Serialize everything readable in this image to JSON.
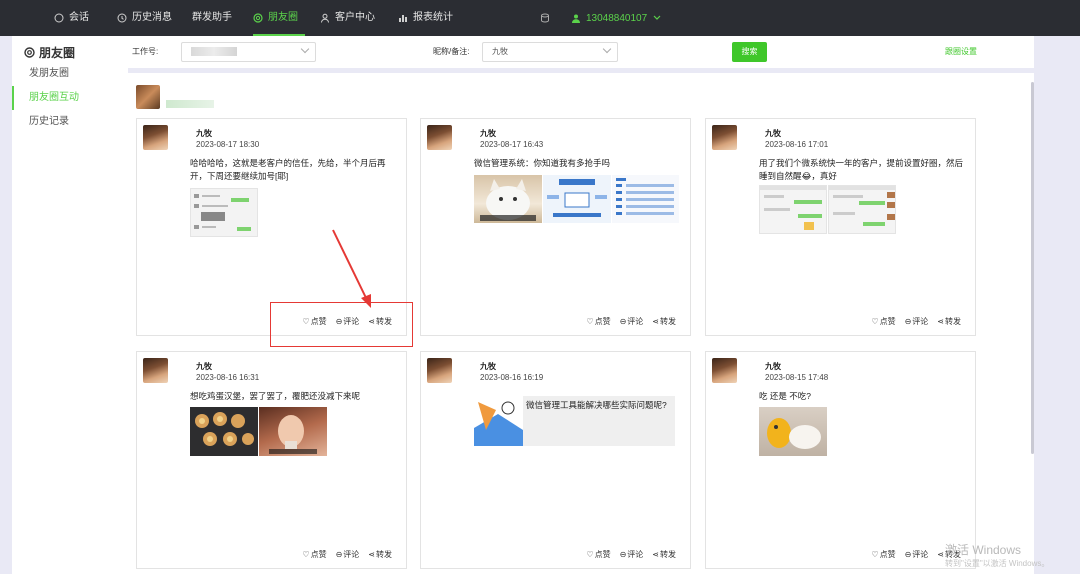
{
  "nav": {
    "items": [
      {
        "label": "会话",
        "icon": "chat-bubble-icon"
      },
      {
        "label": "历史消息",
        "icon": "clock-icon"
      },
      {
        "label": "群发助手",
        "icon": ""
      },
      {
        "label": "朋友圈",
        "icon": "aperture-icon"
      },
      {
        "label": "客户中心",
        "icon": "person-icon"
      },
      {
        "label": "报表统计",
        "icon": "bar-chart-icon"
      }
    ],
    "active_index": 3,
    "phone": "13048840107",
    "accent": "#5bd24b"
  },
  "sidebar": {
    "title": "朋友圈",
    "items": [
      {
        "label": "发朋友圈"
      },
      {
        "label": "朋友圈互动"
      },
      {
        "label": "历史记录"
      }
    ],
    "active_index": 1
  },
  "filters": {
    "work_no_label": "工作号:",
    "nickname_label": "昵称/备注:",
    "nickname_value": "九牧",
    "search_label": "搜索",
    "settings_label": "跟圈设置"
  },
  "posts": [
    {
      "name": "九牧",
      "time": "2023-08-17 18:30",
      "text": "哈哈哈哈，这就是老客户的信任，先给，半个月后再开，下周还要继续加号[耶]",
      "images": [
        "screenshot-chat"
      ]
    },
    {
      "name": "九牧",
      "time": "2023-08-17 16:43",
      "text": "微信管理系统：你知道我有多抢手吗",
      "images": [
        "cat-photo",
        "system-diagram",
        "feature-list"
      ]
    },
    {
      "name": "九牧",
      "time": "2023-08-16 17:01",
      "text": "用了我们个微系统快一年的客户，提前设置好圈，然后睡到自然醒😂，真好",
      "images": [
        "chat-screenshot-1",
        "chat-screenshot-2"
      ]
    },
    {
      "name": "九牧",
      "time": "2023-08-16 16:31",
      "text": "想吃鸡蛋汉堡，罢了罢了，覆肥还没减下来呢",
      "images": [
        "egg-burger-pan",
        "girl-meme"
      ]
    },
    {
      "name": "九牧",
      "time": "2023-08-16 16:19",
      "text": "微信管理工具能解决哪些实际问题呢?",
      "images": [
        "article-thumb"
      ]
    },
    {
      "name": "九牧",
      "time": "2023-08-15 17:48",
      "text": "吃 还是 不吃?",
      "images": [
        "toy-and-food"
      ]
    }
  ],
  "actions": {
    "like": "点赞",
    "comment": "评论",
    "share": "转发"
  },
  "watermark": {
    "line1": "激活 Windows",
    "line2": "转到\"设置\"以激活 Windows。"
  }
}
